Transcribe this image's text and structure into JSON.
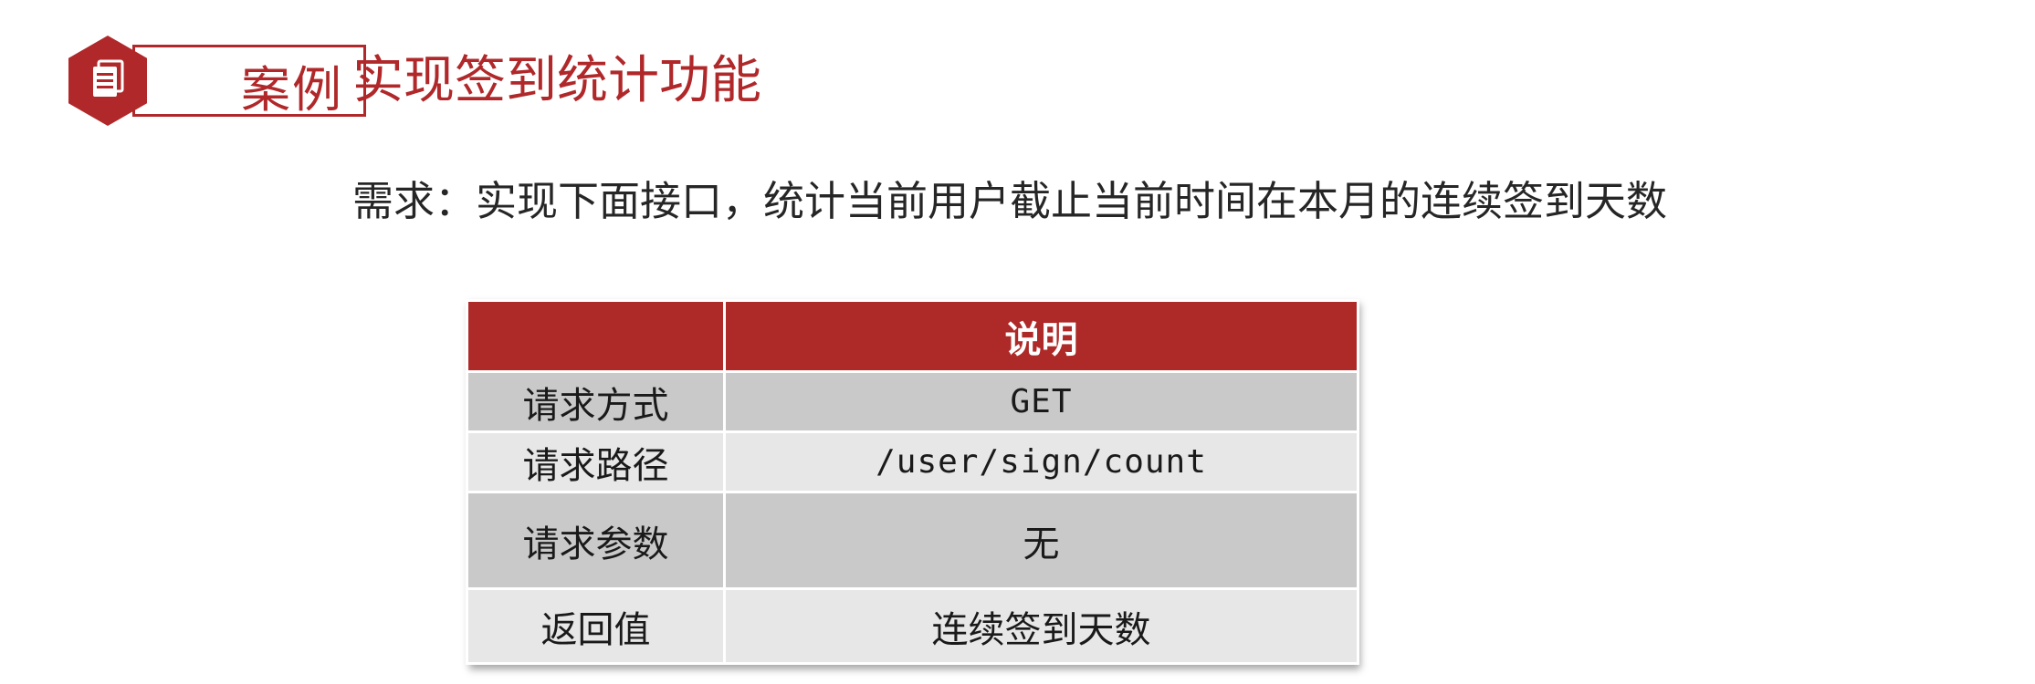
{
  "badge": {
    "label": "案例",
    "icon": "document-icon",
    "color": "#b0282a"
  },
  "title": "实现签到统计功能",
  "requirement": "需求：实现下面接口，统计当前用户截止当前时间在本月的连续签到天数",
  "table": {
    "header": [
      "",
      "说明"
    ],
    "rows": [
      {
        "label": "请求方式",
        "value": "GET"
      },
      {
        "label": "请求路径",
        "value": "/user/sign/count"
      },
      {
        "label": "请求参数",
        "value": "无"
      },
      {
        "label": "返回值",
        "value": "连续签到天数"
      }
    ],
    "header_color": "#ae2a28"
  }
}
